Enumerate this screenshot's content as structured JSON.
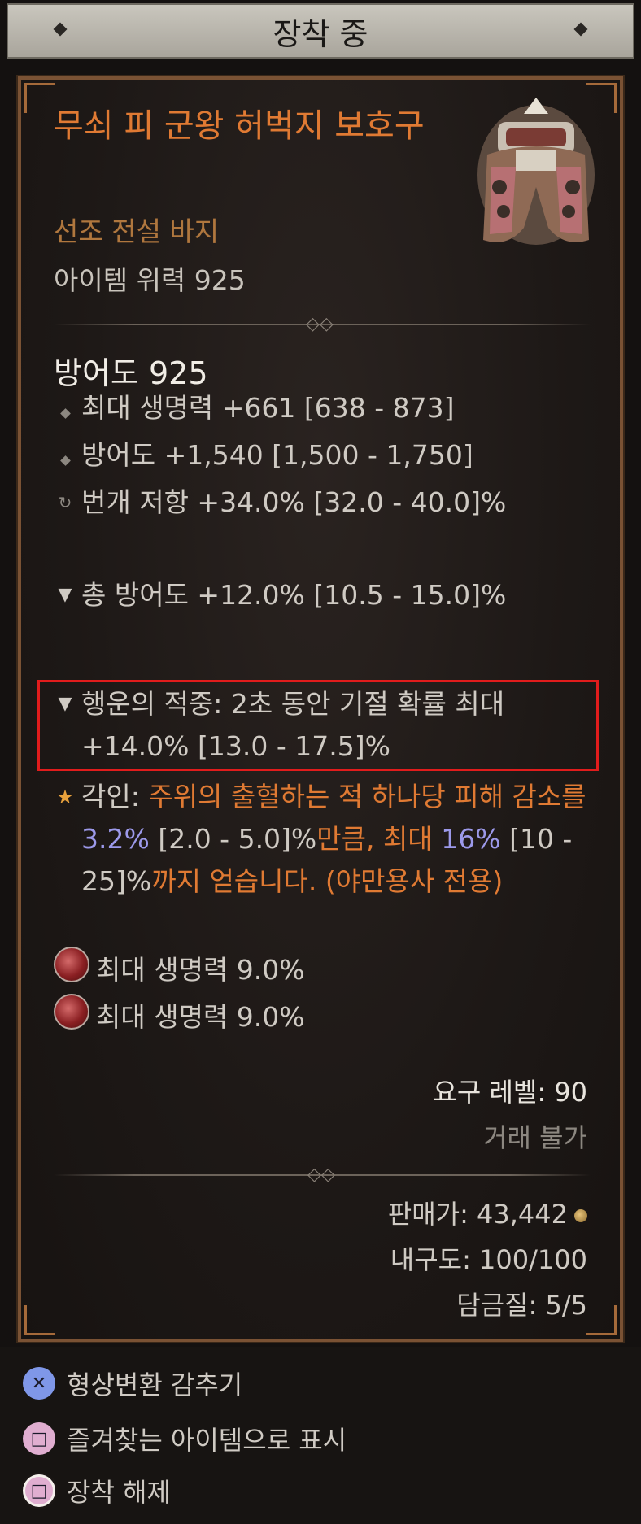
{
  "header": {
    "title": "장착 중"
  },
  "item": {
    "name": "무쇠 피 군왕 허벅지 보호구",
    "type": "선조 전설 바지",
    "power": "아이템 위력 925",
    "armor": "방어도 925",
    "image_icon": "fur-pants-armor-image"
  },
  "affixes": [
    {
      "icon": "diamond-bullet",
      "text": "최대 생명력 +661 [638 - 873]"
    },
    {
      "icon": "diamond-bullet",
      "text": "방어도 +1,540 [1,500 - 1,750]"
    },
    {
      "icon": "resistance-icon",
      "text": "번개 저항 +34.0% [32.0 - 40.0]%"
    },
    {
      "icon": "anvil-icon",
      "text": "총 방어도 +12.0% [10.5 - 15.0]%"
    },
    {
      "icon": "anvil-icon",
      "text": "행운의 적중: 2초 동안 기절 확률 최대 +14.0% [13.0 - 17.5]%"
    }
  ],
  "aspect": {
    "icon": "star-icon",
    "p1": "각인: ",
    "p2": "주위의 출혈하는 적 하나당 피해 감소를 ",
    "p3": "3.2%",
    "p4": " [2.0 - 5.0]%",
    "p5": "만큼, 최대 ",
    "p6": "16%",
    "p7": " [10 - 25]%",
    "p8": "까지 얻습니다. (야만용사 전용)"
  },
  "gems": [
    {
      "icon": "ruby-gem-icon",
      "text": "최대 생명력 9.0%"
    },
    {
      "icon": "ruby-gem-icon",
      "text": "최대 생명력 9.0%"
    }
  ],
  "requirements": {
    "level": "요구 레벨: 90",
    "tradable": "거래 불가"
  },
  "stats": {
    "price": "판매가: 43,442",
    "durability": "내구도: 100/100",
    "temper": "담금질: 5/5"
  },
  "actions": [
    {
      "icon": "cross-button-icon",
      "label": "형상변환 감추기"
    },
    {
      "icon": "square-button-icon",
      "label": "즐겨찾는 아이템으로 표시"
    },
    {
      "icon": "square-button-icon",
      "label": "장착 해제"
    }
  ],
  "colors": {
    "legendary": "#e07a33",
    "highlight_box": "#e11c1c",
    "value_blue": "#9c99ea",
    "frame": "#7a5234"
  }
}
